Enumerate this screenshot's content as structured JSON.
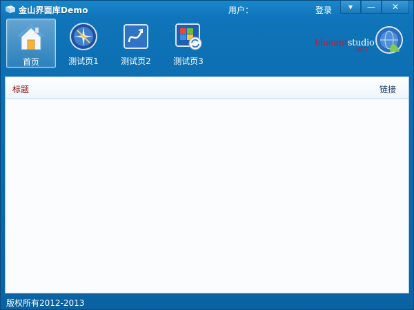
{
  "window": {
    "title": "金山界面库Demo",
    "user_label": "用户：",
    "login_label": "登录",
    "minimize_icon": "▾",
    "restore_icon": "—",
    "close_icon": "✕"
  },
  "nav": {
    "items": [
      {
        "label": "首页",
        "icon": "home-icon",
        "active": true
      },
      {
        "label": "测试页1",
        "icon": "compass-icon",
        "active": false
      },
      {
        "label": "测试页2",
        "icon": "curve-arrow-icon",
        "active": false
      },
      {
        "label": "测试页3",
        "icon": "windows-refresh-icon",
        "active": false
      }
    ]
  },
  "brand": {
    "part1": "blueant",
    "part2": "studio",
    "part3": ".NET",
    "badge_icon": "globe-badge-icon"
  },
  "table": {
    "columns": [
      "标题",
      "链接"
    ],
    "rows": []
  },
  "status": {
    "copyright": "版权所有2012-2013"
  },
  "colors": {
    "frame": "#0f74b9",
    "header_text": "#7a1010",
    "link_header": "#1f3f66",
    "brand_red": "#d0132b"
  }
}
